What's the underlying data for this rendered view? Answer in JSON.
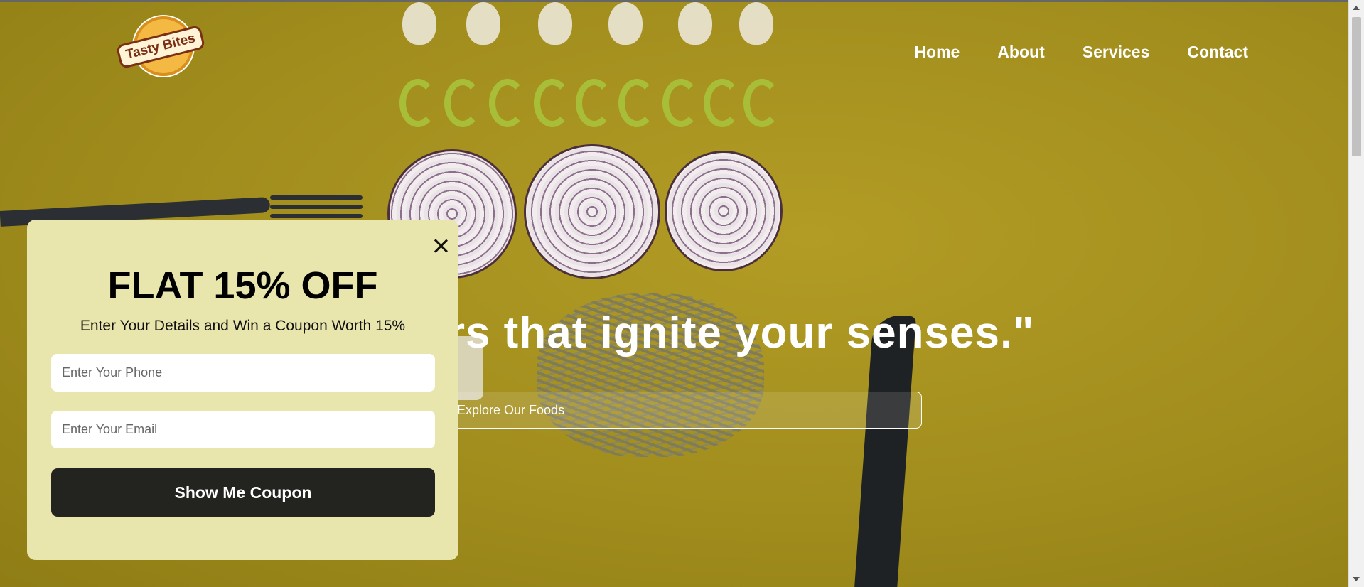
{
  "brand": {
    "name": "Tasty Bites"
  },
  "nav": {
    "items": [
      {
        "label": "Home"
      },
      {
        "label": "About"
      },
      {
        "label": "Services"
      },
      {
        "label": "Contact"
      }
    ]
  },
  "hero": {
    "headline_visible": "avors that ignite your senses.\"",
    "cta_label": "Explore Our Foods"
  },
  "popup": {
    "title": "FLAT 15% OFF",
    "subtitle": "Enter Your Details and Win a Coupon Worth 15%",
    "phone_placeholder": "Enter Your Phone",
    "email_placeholder": "Enter Your Email",
    "submit_label": "Show Me Coupon"
  },
  "colors": {
    "hero_background": "#a3901f",
    "popup_background": "#e9e6ad",
    "button_dark": "#23231f",
    "text_light": "#ffffff"
  },
  "icons": {
    "close": "close-icon",
    "scroll_up": "chevron-up-icon",
    "scroll_down": "chevron-down-icon"
  }
}
